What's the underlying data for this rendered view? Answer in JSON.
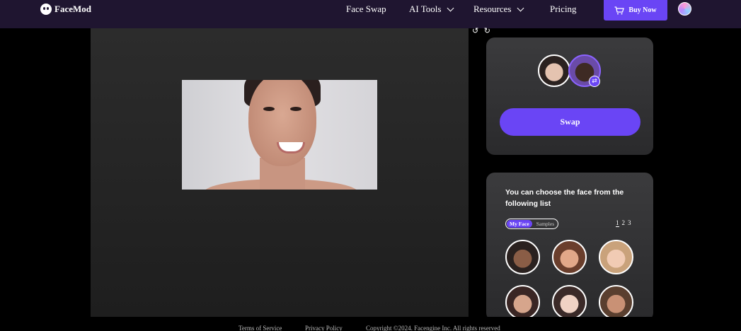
{
  "nav": {
    "logo_text": "FaceMod",
    "links": [
      {
        "label": "Face Swap"
      },
      {
        "label": "AI Tools"
      },
      {
        "label": "Resources"
      },
      {
        "label": "Pricing"
      }
    ],
    "buy_label": "Buy Now"
  },
  "canvas": {
    "undo_redo": "↺ ↻"
  },
  "swap_panel": {
    "swap_badge": "⇄",
    "swap_label": "Swap"
  },
  "face_list": {
    "title": "You can choose the face from the following list",
    "tabs": [
      {
        "label": "My Face",
        "active": true
      },
      {
        "label": "Samples",
        "active": false
      }
    ],
    "pages": [
      "1",
      "2",
      "3"
    ],
    "current_page": "1"
  },
  "footer": {
    "terms": "Terms of Service",
    "privacy": "Privacy Policy",
    "copyright": "Copyright ©2024. Facengine Inc. All rights reserved"
  },
  "colors": {
    "accent": "#6a45f5",
    "nav_bg": "#1f1530",
    "panel_bg": "#333335"
  }
}
